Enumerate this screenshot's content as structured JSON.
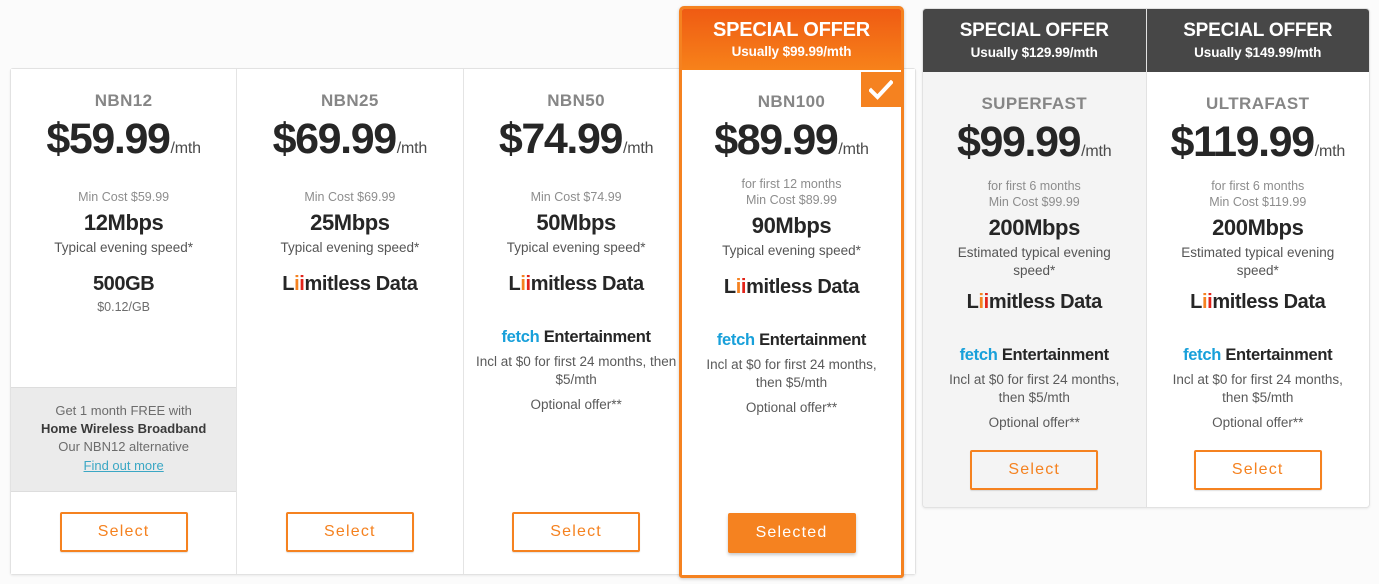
{
  "colors": {
    "brand_orange": "#f58220",
    "accent_red": "#e2231a",
    "fetch_blue": "#18a0da",
    "dark_banner": "#474747",
    "link_blue": "#3ba7c4"
  },
  "plans": [
    {
      "name": "NBN12",
      "price": "$59.99",
      "price_suffix": "/mth",
      "term_note": "",
      "min_cost": "Min Cost $59.99",
      "speed": "12Mbps",
      "speed_label": "Typical evening speed*",
      "data": "500GB",
      "data_sub": "$0.12/GB",
      "promo": {
        "line1": "Get 1 month FREE with",
        "line2": "Home Wireless Broadband",
        "line3": "Our NBN12 alternative",
        "link": "Find out more"
      },
      "button": "Select"
    },
    {
      "name": "NBN25",
      "price": "$69.99",
      "price_suffix": "/mth",
      "term_note": "",
      "min_cost": "Min Cost $69.99",
      "speed": "25Mbps",
      "speed_label": "Typical evening speed*",
      "data_prefix": "L",
      "data_i1": "i",
      "data_i2": "i",
      "data_rest": "mitless Data",
      "button": "Select"
    },
    {
      "name": "NBN50",
      "price": "$74.99",
      "price_suffix": "/mth",
      "term_note": "",
      "min_cost": "Min Cost $74.99",
      "speed": "50Mbps",
      "speed_label": "Typical evening speed*",
      "data_prefix": "L",
      "data_i1": "i",
      "data_i2": "i",
      "data_rest": "mitless Data",
      "fetch_brand": "fetch",
      "fetch_label": "Entertainment",
      "fetch_note": "Incl at $0 for first 24 months, then $5/mth",
      "fetch_optional": "Optional offer**",
      "button": "Select"
    }
  ],
  "offer_plan": {
    "banner_title": "SPECIAL OFFER",
    "banner_sub": "Usually $99.99/mth",
    "check_icon": "check-icon",
    "name": "NBN100",
    "price": "$89.99",
    "price_suffix": "/mth",
    "term_note": "for first 12 months",
    "min_cost": "Min Cost $89.99",
    "speed": "90Mbps",
    "speed_label": "Typical evening speed*",
    "data_prefix": "L",
    "data_i1": "i",
    "data_i2": "i",
    "data_rest": "mitless Data",
    "fetch_brand": "fetch",
    "fetch_label": "Entertainment",
    "fetch_note": "Incl at $0 for first 24 months, then $5/mth",
    "fetch_optional": "Optional offer**",
    "button": "Selected"
  },
  "premium_plans": [
    {
      "banner_title": "SPECIAL OFFER",
      "banner_sub": "Usually $129.99/mth",
      "name": "SUPERFAST",
      "price": "$99.99",
      "price_suffix": "/mth",
      "term_note": "for first 6 months",
      "min_cost": "Min Cost $99.99",
      "speed": "200Mbps",
      "speed_label": "Estimated typical evening speed*",
      "data_prefix": "L",
      "data_i1": "i",
      "data_i2": "i",
      "data_rest": "mitless Data",
      "fetch_brand": "fetch",
      "fetch_label": "Entertainment",
      "fetch_note": "Incl at $0 for first 24 months, then $5/mth",
      "fetch_optional": "Optional offer**",
      "button": "Select"
    },
    {
      "banner_title": "SPECIAL OFFER",
      "banner_sub": "Usually $149.99/mth",
      "name": "ULTRAFAST",
      "price": "$119.99",
      "price_suffix": "/mth",
      "term_note": "for first 6 months",
      "min_cost": "Min Cost $119.99",
      "speed": "200Mbps",
      "speed_label": "Estimated typical evening speed*",
      "data_prefix": "L",
      "data_i1": "i",
      "data_i2": "i",
      "data_rest": "mitless Data",
      "fetch_brand": "fetch",
      "fetch_label": "Entertainment",
      "fetch_note": "Incl at $0 for first 24 months, then $5/mth",
      "fetch_optional": "Optional offer**",
      "button": "Select"
    }
  ]
}
